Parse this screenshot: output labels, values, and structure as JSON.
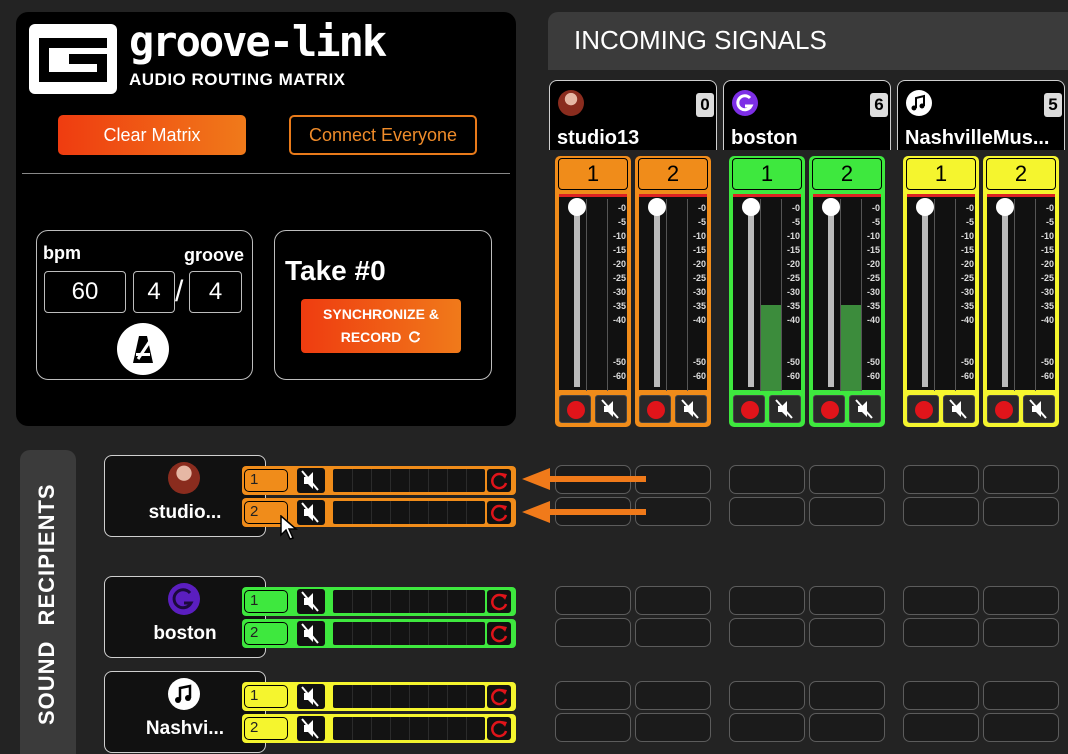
{
  "brand": {
    "name": "groove-link",
    "tagline": "AUDIO ROUTING MATRIX"
  },
  "controls": {
    "clear_label": "Clear Matrix",
    "connect_label": "Connect Everyone",
    "bpm_label": "bpm",
    "groove_label": "groove",
    "bpm_value": "60",
    "groove_numerator": "4",
    "groove_denominator": "4",
    "take_label": "Take #0",
    "sync_line1": "SYNCHRONIZE &",
    "sync_line2": "RECORD"
  },
  "colors": {
    "orange": "#f08c1a",
    "green": "#3ee83e",
    "yellow": "#f5f52e",
    "record_red": "#e0141a",
    "accent": "#f07a1a"
  },
  "incoming": {
    "title": "INCOMING SIGNALS",
    "sources": [
      {
        "name": "studio13",
        "count": "0",
        "icon": "avatar-photo",
        "color": "#f08c1a",
        "channels": [
          "1",
          "2"
        ]
      },
      {
        "name": "boston",
        "count": "6",
        "icon": "g-logo",
        "color": "#3ee83e",
        "channels": [
          "1",
          "2"
        ]
      },
      {
        "name": "NashvilleMus...",
        "count": "5",
        "icon": "music-note-icon",
        "color": "#f5f52e",
        "channels": [
          "1",
          "2"
        ]
      }
    ],
    "meter_levels": [
      0,
      0,
      0.45,
      0.45,
      0,
      0
    ],
    "scale": [
      "-0",
      "-5",
      "-10",
      "-15",
      "-20",
      "-25",
      "-30",
      "-35",
      "-40",
      "-50",
      "-60"
    ]
  },
  "recipients": {
    "title": "SOUND RECIPIENTS",
    "items": [
      {
        "name": "studio...",
        "icon": "avatar-photo",
        "color": "#f08c1a",
        "channels": [
          "1",
          "2"
        ]
      },
      {
        "name": "boston",
        "icon": "g-logo",
        "color": "#3ee83e",
        "channels": [
          "1",
          "2"
        ]
      },
      {
        "name": "Nashvi...",
        "icon": "music-note-icon",
        "color": "#f5f52e",
        "channels": [
          "1",
          "2"
        ]
      }
    ]
  }
}
